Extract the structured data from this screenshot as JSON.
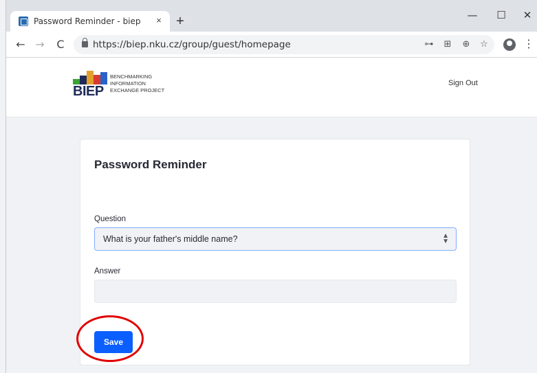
{
  "browser": {
    "tab_title": "Password Reminder - biep",
    "tab_close": "×",
    "new_tab": "+",
    "url": "https://biep.nku.cz/group/guest/homepage",
    "back": "←",
    "forward": "→",
    "reload": "C",
    "key_icon": "⊶",
    "translate_icon": "⊞",
    "zoom_icon": "⊕",
    "star_icon": "☆",
    "menu": "⋮",
    "minimize": "—",
    "maximize": "☐",
    "close": "✕"
  },
  "site": {
    "logo_word": "BIEP",
    "logo_tagline": [
      "BENCHMARKING",
      "INFORMATION",
      "EXCHANGE PROJECT"
    ],
    "logo_colors": [
      "#3aa335",
      "#1e2b58",
      "#e2a02a",
      "#d93a2e",
      "#2a62c9"
    ],
    "sign_out": "Sign Out"
  },
  "form": {
    "title": "Password Reminder",
    "question_label": "Question",
    "question_value": "What is your father's middle name?",
    "answer_label": "Answer",
    "answer_value": "",
    "save_label": "Save"
  },
  "colors": {
    "primary": "#0b5fff",
    "highlight": "#e00000"
  }
}
